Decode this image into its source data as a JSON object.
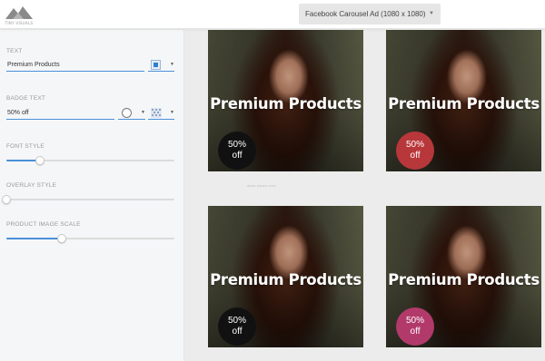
{
  "header": {
    "logo_text": "TINY VISUALS",
    "format_select": {
      "value": "Facebook Carousel Ad (1080 x 1080)",
      "icon": "chevron-down-icon"
    }
  },
  "sidebar": {
    "text": {
      "label": "TEXT",
      "value": "Premium Products"
    },
    "badge_text": {
      "label": "BADGE TEXT",
      "value": "50% off"
    },
    "font_style": {
      "label": "FONT STYLE",
      "value": 0.2
    },
    "overlay_style": {
      "label": "OVERLAY STYLE",
      "value": 0.0
    },
    "product_image_scale": {
      "label": "PRODUCT IMAGE SCALE",
      "value": 0.33
    }
  },
  "colors": {
    "accent": "#4a90d9",
    "text_color_swatch": "#2f7fd1",
    "badge_color_swatch": "#ffffff"
  },
  "cards": [
    {
      "headline": "Premium Products",
      "badge_line1": "50%",
      "badge_line2": "off",
      "badge_color": "#111111"
    },
    {
      "headline": "Premium Products",
      "badge_line1": "50%",
      "badge_line2": "off",
      "badge_color": "#b8373a"
    },
    {
      "headline": "Premium Products",
      "badge_line1": "50%",
      "badge_line2": "off",
      "badge_color": "#111111"
    },
    {
      "headline": "Premium Products",
      "badge_line1": "50%",
      "badge_line2": "off",
      "badge_color": "#b23a6a"
    }
  ],
  "watermark": "www.wpwo.com"
}
